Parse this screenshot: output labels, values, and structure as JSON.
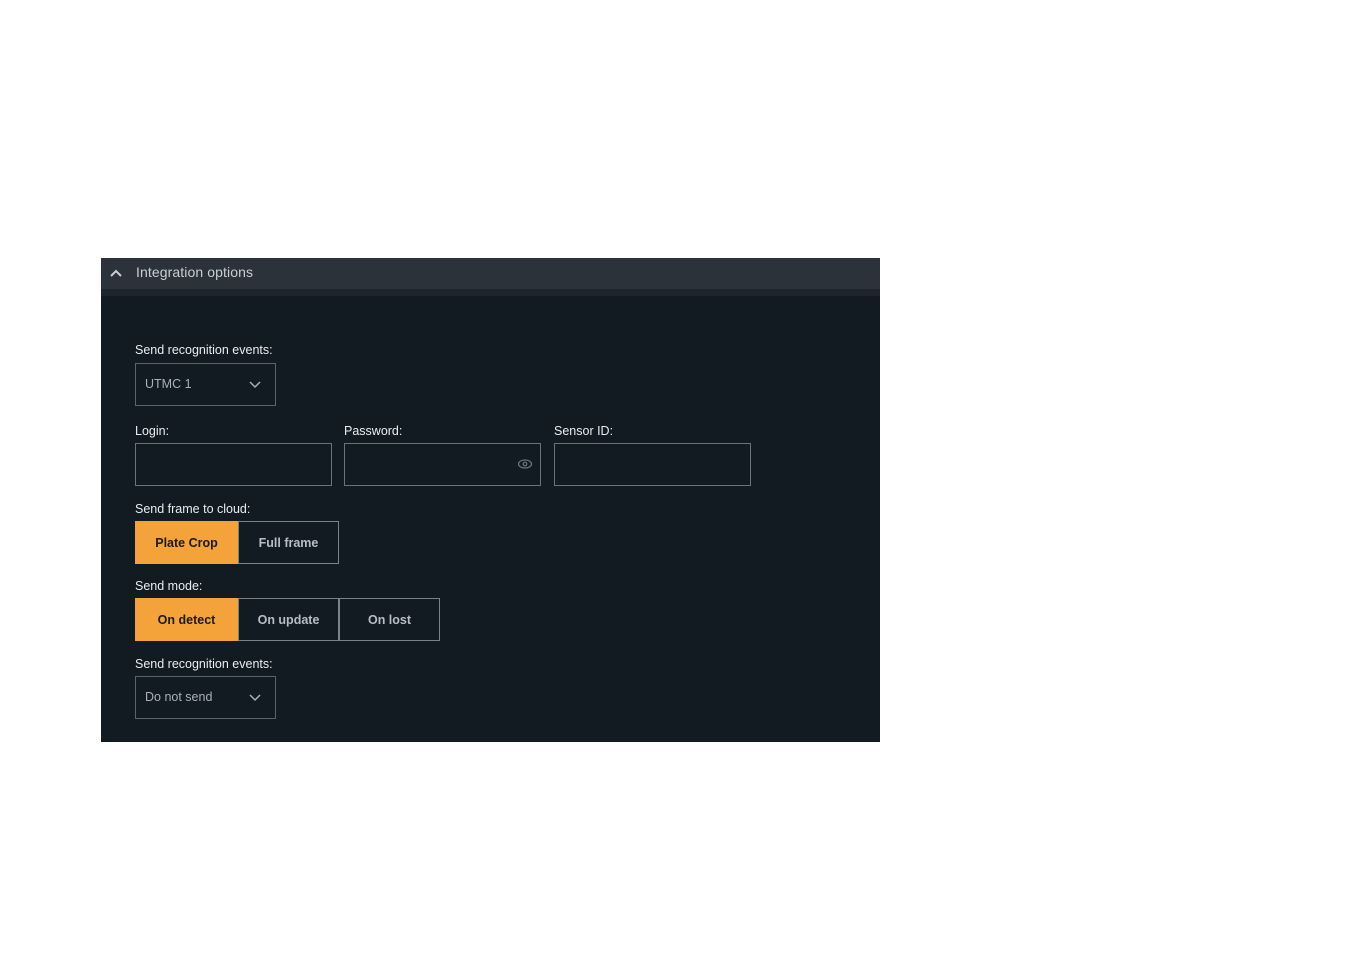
{
  "panel": {
    "title": "Integration options",
    "collapse_icon": "chevron-up-icon"
  },
  "recognition_events_1": {
    "label": "Send recognition events:",
    "value": "UTMC 1"
  },
  "login": {
    "label": "Login:",
    "value": ""
  },
  "password": {
    "label": "Password:",
    "value": "",
    "icon": "eye-icon"
  },
  "sensor_id": {
    "label": "Sensor ID:",
    "value": ""
  },
  "frame_to_cloud": {
    "label": "Send frame to cloud:",
    "options": [
      "Plate Crop",
      "Full frame"
    ],
    "selected": "Plate Crop"
  },
  "send_mode": {
    "label": "Send mode:",
    "options": [
      "On detect",
      "On update",
      "On lost"
    ],
    "selected": "On detect"
  },
  "recognition_events_2": {
    "label": "Send recognition events:",
    "value": "Do not send"
  },
  "colors": {
    "accent": "#f4a23a",
    "panel_bg": "#121a22",
    "header_bg": "#2b323a"
  }
}
